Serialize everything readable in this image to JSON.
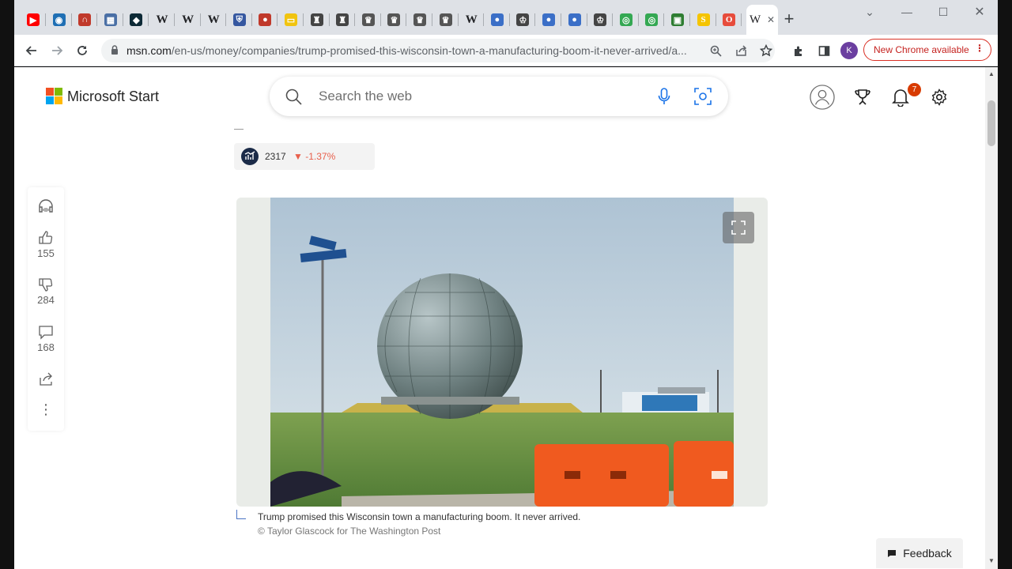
{
  "browser": {
    "tabs": [
      {
        "icon": "youtube-icon",
        "color": "#ff0000",
        "glyph": "▶"
      },
      {
        "icon": "globe-icon",
        "color": "#1f6fb4",
        "glyph": "◉"
      },
      {
        "icon": "arc-icon",
        "color": "#c0392b",
        "glyph": "∩"
      },
      {
        "icon": "calendar-icon",
        "color": "#4a6fa5",
        "glyph": "▦"
      },
      {
        "icon": "dark-site-icon",
        "color": "#0d2a36",
        "glyph": "◆"
      },
      {
        "icon": "wikipedia-icon",
        "color": "#ffffff",
        "glyph": "W"
      },
      {
        "icon": "wikipedia-icon",
        "color": "#ffffff",
        "glyph": "W"
      },
      {
        "icon": "wikipedia-icon",
        "color": "#ffffff",
        "glyph": "W"
      },
      {
        "icon": "shield-icon",
        "color": "#3557a0",
        "glyph": "⛨"
      },
      {
        "icon": "ball-icon",
        "color": "#c0392b",
        "glyph": "●"
      },
      {
        "icon": "yellow-square-icon",
        "color": "#f1c40f",
        "glyph": "▭"
      },
      {
        "icon": "chess-icon",
        "color": "#444444",
        "glyph": "♜"
      },
      {
        "icon": "chess-icon",
        "color": "#444444",
        "glyph": "♜"
      },
      {
        "icon": "crest-icon",
        "color": "#555555",
        "glyph": "♛"
      },
      {
        "icon": "crest-icon",
        "color": "#555555",
        "glyph": "♛"
      },
      {
        "icon": "crest-icon",
        "color": "#555555",
        "glyph": "♛"
      },
      {
        "icon": "crest-icon",
        "color": "#555555",
        "glyph": "♛"
      },
      {
        "icon": "wikipedia-icon",
        "color": "#ffffff",
        "glyph": "W"
      },
      {
        "icon": "blue-globe-icon",
        "color": "#3b6fc7",
        "glyph": "●"
      },
      {
        "icon": "crown-icon",
        "color": "#444444",
        "glyph": "♔"
      },
      {
        "icon": "blue-globe-icon",
        "color": "#3b6fc7",
        "glyph": "●"
      },
      {
        "icon": "blue-globe-icon",
        "color": "#3b6fc7",
        "glyph": "●"
      },
      {
        "icon": "crown-icon",
        "color": "#444444",
        "glyph": "♔"
      },
      {
        "icon": "owl-icon",
        "color": "#34a853",
        "glyph": "◎"
      },
      {
        "icon": "owl-icon",
        "color": "#34a853",
        "glyph": "◎"
      },
      {
        "icon": "green-grid-icon",
        "color": "#2e7d32",
        "glyph": "▣"
      },
      {
        "icon": "s-logo-icon",
        "color": "#f5c400",
        "glyph": "S"
      },
      {
        "icon": "opera-icon",
        "color": "#e74c3c",
        "glyph": "O"
      }
    ],
    "active_tab": {
      "glyph": "W",
      "close": "✕"
    },
    "new_tab": "+",
    "window_controls": {
      "minimize": "—",
      "maximize": "☐",
      "close": "✕",
      "chevron": "⌄"
    },
    "url_host": "msn.com",
    "url_path": "/en-us/money/companies/trump-promised-this-wisconsin-town-a-manufacturing-boom-it-never-arrived/a...",
    "profile_initial": "K",
    "update_chip": "New Chrome available"
  },
  "header": {
    "brand": "Microsoft Start",
    "search_placeholder": "Search the web",
    "notification_count": "7",
    "colors": {
      "red": "#f25022",
      "green": "#7fba00",
      "blue": "#00a4ef",
      "yellow": "#ffb900"
    }
  },
  "ticker": {
    "value": "2317",
    "change": "▼ -1.37%"
  },
  "rail": {
    "likes": "155",
    "dislikes": "284",
    "comments": "168"
  },
  "article": {
    "caption": "Trump promised this Wisconsin town a manufacturing boom. It never arrived.",
    "credit": "© Taylor Glascock for The Washington Post"
  },
  "feedback_label": "Feedback"
}
